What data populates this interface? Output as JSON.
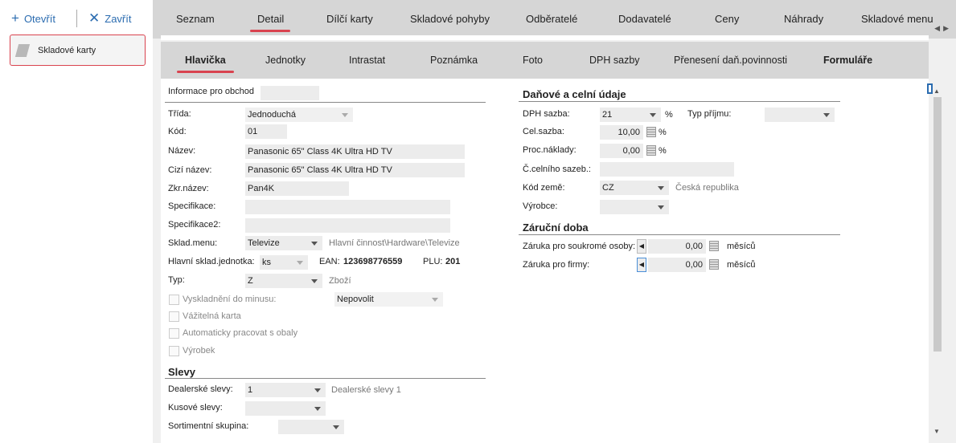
{
  "toolbar": {
    "open": "Otevřít",
    "close": "Zavřít"
  },
  "left": {
    "card_label": "Skladové karty"
  },
  "tabs1": [
    "Seznam",
    "Detail",
    "Dílčí karty",
    "Skladové pohyby",
    "Odběratelé",
    "Dodavatelé",
    "Ceny",
    "Náhrady",
    "Skladové menu"
  ],
  "tabs2": [
    "Hlavička",
    "Jednotky",
    "Intrastat",
    "Poznámka",
    "Foto",
    "DPH sazby",
    "Přenesení daň.povinnosti",
    "Formuláře"
  ],
  "form": {
    "info_label": "Informace pro obchod",
    "trida_label": "Třída:",
    "trida": "Jednoduchá",
    "kod_label": "Kód:",
    "kod": "01",
    "nazev_label": "Název:",
    "nazev": "Panasonic 65\" Class 4K Ultra HD TV",
    "cizi_label": "Cizí název:",
    "cizi": "Panasonic 65\" Class 4K Ultra HD TV",
    "zkr_label": "Zkr.název:",
    "zkr": "Pan4K",
    "spec_label": "Specifikace:",
    "spec2_label": "Specifikace2:",
    "sklmenu_label": "Sklad.menu:",
    "sklmenu": "Televize",
    "sklmenu_path": "Hlavní činnost\\Hardware\\Televize",
    "jedn_label": "Hlavní sklad.jednotka:",
    "jedn": "ks",
    "ean_label": "EAN:",
    "ean": "123698776559",
    "plu_label": "PLU:",
    "plu": "201",
    "typ_label": "Typ:",
    "typ": "Z",
    "typ_hint": "Zboží",
    "chk1": "Vyskladnění do minusu:",
    "chk1_value": "Nepovolit",
    "chk2": "Vážitelná karta",
    "chk3": "Automaticky pracovat s obaly",
    "chk4": "Výrobek",
    "slevy_hdr": "Slevy",
    "dealer_label": "Dealerské slevy:",
    "dealer": "1",
    "dealer_hint": "Dealerské slevy 1",
    "kus_label": "Kusové slevy:",
    "sort_label": "Sortimentní skupina:"
  },
  "right": {
    "dan_hdr": "Daňové a celní údaje",
    "dph_label": "DPH sazba:",
    "dph": "21",
    "pct": "%",
    "typ_prijmu_label": "Typ příjmu:",
    "cel_label": "Cel.sazba:",
    "cel": "10,00",
    "proc_label": "Proc.náklady:",
    "proc": "0,00",
    "celni_label": "Č.celního sazeb.:",
    "zeme_label": "Kód země:",
    "zeme": "CZ",
    "zeme_hint": "Česká republika",
    "vyrobce_label": "Výrobce:",
    "zaruka_hdr": "Záruční doba",
    "zar1_label": "Záruka pro soukromé osoby:",
    "zar1": "0,00",
    "zar2_label": "Záruka pro firmy:",
    "zar2": "0,00",
    "mesicu": "měsíců"
  },
  "colors": {
    "accent": "#d9434f",
    "link": "#2b6cb0"
  }
}
